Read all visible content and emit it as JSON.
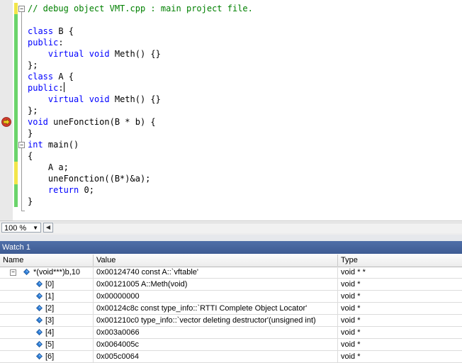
{
  "editor": {
    "lines": [
      {
        "parts": [
          {
            "t": "// debug object VMT.cpp : main project file.",
            "c": "cm"
          }
        ]
      },
      {
        "parts": []
      },
      {
        "parts": [
          {
            "t": "class",
            "c": "kw"
          },
          {
            "t": " B {",
            "c": ""
          }
        ]
      },
      {
        "parts": [
          {
            "t": "public",
            "c": "kw"
          },
          {
            "t": ":",
            "c": ""
          }
        ]
      },
      {
        "parts": [
          {
            "t": "    ",
            "c": ""
          },
          {
            "t": "virtual",
            "c": "kw"
          },
          {
            "t": " ",
            "c": ""
          },
          {
            "t": "void",
            "c": "kw"
          },
          {
            "t": " Meth() {}",
            "c": ""
          }
        ]
      },
      {
        "parts": [
          {
            "t": "};",
            "c": ""
          }
        ]
      },
      {
        "parts": [
          {
            "t": "class",
            "c": "kw"
          },
          {
            "t": " A {",
            "c": ""
          }
        ]
      },
      {
        "parts": [
          {
            "t": "public",
            "c": "kw"
          },
          {
            "t": ":",
            "c": ""
          }
        ],
        "caret": true
      },
      {
        "parts": [
          {
            "t": "    ",
            "c": ""
          },
          {
            "t": "virtual",
            "c": "kw"
          },
          {
            "t": " ",
            "c": ""
          },
          {
            "t": "void",
            "c": "kw"
          },
          {
            "t": " Meth() {}",
            "c": ""
          }
        ]
      },
      {
        "parts": [
          {
            "t": "};",
            "c": ""
          }
        ]
      },
      {
        "parts": [
          {
            "t": "void",
            "c": "kw"
          },
          {
            "t": " uneFonction(B * b) {",
            "c": ""
          }
        ]
      },
      {
        "parts": [
          {
            "t": "}",
            "c": ""
          }
        ]
      },
      {
        "parts": [
          {
            "t": "int",
            "c": "kw"
          },
          {
            "t": " main()",
            "c": ""
          }
        ]
      },
      {
        "parts": [
          {
            "t": "{",
            "c": ""
          }
        ]
      },
      {
        "parts": [
          {
            "t": "    A a;",
            "c": ""
          }
        ]
      },
      {
        "parts": [
          {
            "t": "    uneFonction((B*)&a);",
            "c": ""
          }
        ]
      },
      {
        "parts": [
          {
            "t": "    ",
            "c": ""
          },
          {
            "t": "return",
            "c": "kw"
          },
          {
            "t": " 0;",
            "c": ""
          }
        ]
      },
      {
        "parts": [
          {
            "t": "}",
            "c": ""
          }
        ]
      }
    ],
    "current_statement_line": 11,
    "colors": {
      "keyword": "#0000ff",
      "comment": "#008000",
      "text": "#000000",
      "changed_saved": "#6bd46b",
      "changed_unsaved": "#f2e64a"
    }
  },
  "zoom": {
    "value": "100 %"
  },
  "watch": {
    "title": "Watch 1",
    "columns": {
      "name": "Name",
      "value": "Value",
      "type": "Type"
    },
    "rows": [
      {
        "name": "*(void***)b,10",
        "value": "0x00124740 const A::`vftable'",
        "type": "void * *",
        "expanded": true,
        "level": 0
      },
      {
        "name": "[0]",
        "value": "0x00121005 A::Meth(void)",
        "type": "void *",
        "level": 1
      },
      {
        "name": "[1]",
        "value": "0x00000000",
        "type": "void *",
        "level": 1
      },
      {
        "name": "[2]",
        "value": "0x00124c8c const type_info::`RTTI Complete Object Locator'",
        "type": "void *",
        "level": 1
      },
      {
        "name": "[3]",
        "value": "0x001210c0 type_info::`vector deleting destructor'(unsigned int)",
        "type": "void *",
        "level": 1
      },
      {
        "name": "[4]",
        "value": "0x003a0066",
        "type": "void *",
        "level": 1
      },
      {
        "name": "[5]",
        "value": "0x0064005c",
        "type": "void *",
        "level": 1
      },
      {
        "name": "[6]",
        "value": "0x005c0064",
        "type": "void *",
        "level": 1
      }
    ]
  }
}
